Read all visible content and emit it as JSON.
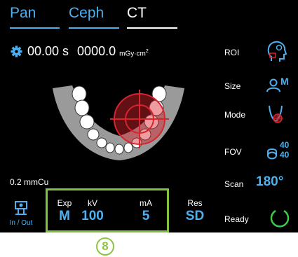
{
  "tabs": [
    {
      "label": "Pan",
      "active": false
    },
    {
      "label": "Ceph",
      "active": false
    },
    {
      "label": "CT",
      "active": true
    }
  ],
  "readout": {
    "gear_icon": "gear-icon",
    "time": "00.00 s",
    "dose": "0000.0",
    "dose_unit": "mGy·cm",
    "dose_unit_exp": "2"
  },
  "filter_label": "0.2 mmCu",
  "in_out": {
    "label": "In / Out",
    "icon": "patient-positioning-icon"
  },
  "params": {
    "exp": {
      "label": "Exp",
      "value": "M"
    },
    "kv": {
      "label": "kV",
      "value": "100"
    },
    "ma": {
      "label": "mA",
      "value": "5"
    },
    "res": {
      "label": "Res",
      "value": "SD"
    }
  },
  "side": {
    "roi": {
      "label": "ROI",
      "icon": "head-roi-icon"
    },
    "size": {
      "label": "Size",
      "icon": "patient-size-icon",
      "size_value": "M"
    },
    "mode": {
      "label": "Mode",
      "icon": "jaw-mode-icon"
    },
    "fov": {
      "label": "FOV",
      "icon": "fov-icon",
      "value_top": "40",
      "value_bottom": "40"
    },
    "scan": {
      "label": "Scan",
      "value": "180°"
    },
    "ready": {
      "label": "Ready",
      "icon": "ready-ring-icon"
    }
  },
  "step_marker": "8",
  "colors": {
    "accent": "#4fb0f0",
    "highlight": "#7ec242",
    "target": "#d9232d"
  }
}
